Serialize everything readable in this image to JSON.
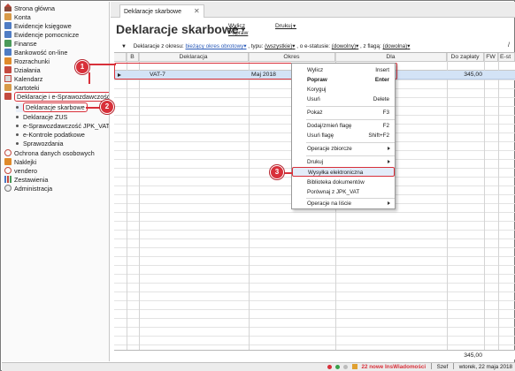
{
  "sidebar": {
    "items": [
      {
        "label": "Strona główna",
        "icon": "home-icon"
      },
      {
        "label": "Konta",
        "icon": "folder-icon"
      },
      {
        "label": "Ewidencje księgowe",
        "icon": "ledger-icon"
      },
      {
        "label": "Ewidencje pomocnicze",
        "icon": "ledger-icon"
      },
      {
        "label": "Finanse",
        "icon": "finance-icon"
      },
      {
        "label": "Bankowość on-line",
        "icon": "bank-icon"
      },
      {
        "label": "Rozrachunki",
        "icon": "settlements-icon"
      },
      {
        "label": "Działania",
        "icon": "actions-icon"
      },
      {
        "label": "Kalendarz",
        "icon": "calendar-icon"
      },
      {
        "label": "Kartoteki",
        "icon": "cards-icon"
      },
      {
        "label": "Deklaracje i e-Sprawozdawczość",
        "icon": "declarations-icon"
      }
    ],
    "sub_items": [
      {
        "label": "Deklaracje skarbowe"
      },
      {
        "label": "Deklaracje ZUS"
      },
      {
        "label": "e-Sprawozdawczość JPK_VAT"
      },
      {
        "label": "e-Kontrole podatkowe"
      },
      {
        "label": "Sprawozdania"
      }
    ],
    "items_after": [
      {
        "label": "Ochrona danych osobowych",
        "icon": "privacy-icon"
      },
      {
        "label": "Naklejki",
        "icon": "stickers-icon"
      },
      {
        "label": "vendero",
        "icon": "vendero-icon"
      },
      {
        "label": "Zestawienia",
        "icon": "reports-icon"
      },
      {
        "label": "Administracja",
        "icon": "admin-icon"
      }
    ]
  },
  "tab": {
    "label": "Deklaracje skarbowe",
    "close": "✕"
  },
  "header": {
    "title": "Deklaracje skarbowe",
    "caret": "▾",
    "actions": {
      "calculate": "Wylicz",
      "correct": "Popraw",
      "print": "Drukuj"
    }
  },
  "filter": {
    "sort_marker": "▼",
    "period_label": "Deklaracje z okresu:",
    "period_value": "bieżący okres obrotowy",
    "type_label": ", typu:",
    "type_value": "(wszystkie)",
    "estatus_label": ", o e-statusie:",
    "estatus_value": "(dowolny)",
    "flag_label": ", z flagą:",
    "flag_value": "(dowolna)",
    "slash": "/"
  },
  "table": {
    "columns": [
      "B",
      "Deklaracja",
      "Okres",
      "Dla",
      "Do zapłaty",
      "FW",
      "E-st"
    ],
    "rows": [
      {
        "deklaracja": "VAT-7",
        "okres": "Maj 2018",
        "dla": "",
        "do_zaplaty": "345,00"
      }
    ],
    "total": "345,00"
  },
  "context_menu": {
    "items": [
      {
        "label": "Wylicz",
        "shortcut": "Insert"
      },
      {
        "label": "Popraw",
        "shortcut": "Enter",
        "bold": true
      },
      {
        "label": "Koryguj",
        "shortcut": ""
      },
      {
        "label": "Usuń",
        "shortcut": "Delete"
      },
      {
        "label": "Pokaż",
        "shortcut": "F3"
      },
      {
        "label": "Dodaj/zmień flagę",
        "shortcut": "F2"
      },
      {
        "label": "Usuń flagę",
        "shortcut": "Shift+F2"
      },
      {
        "label": "Operacje zbiorcze",
        "submenu": true
      },
      {
        "label": "Drukuj",
        "submenu": true
      },
      {
        "label": "Wysyłka elektroniczna",
        "highlighted": true
      },
      {
        "label": "Biblioteka dokumentów"
      },
      {
        "label": "Porównaj z JPK_VAT"
      },
      {
        "label": "Operacje na liście",
        "submenu": true
      }
    ]
  },
  "callouts": [
    "1",
    "2",
    "3"
  ],
  "status": {
    "news": "22 nowe InsWiadomości",
    "user": "Szef",
    "date": "wtorek, 22 maja 2018"
  },
  "colors": {
    "accent_red": "#d8303a",
    "selection": "#d3e3f6",
    "link_blue": "#2859b8"
  }
}
